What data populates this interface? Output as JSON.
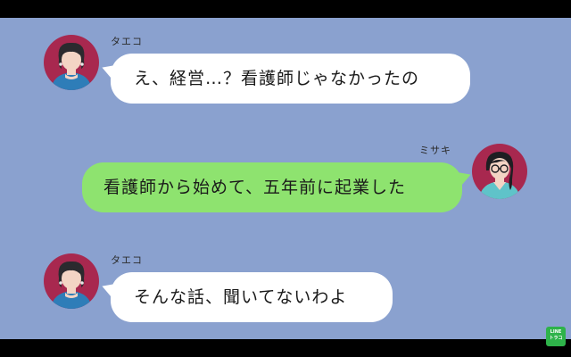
{
  "messages": [
    {
      "sender": "タエコ",
      "side": "left",
      "text": "え、経営…？看護師じゃなかったの"
    },
    {
      "sender": "ミサキ",
      "side": "right",
      "text": "看護師から始めて、五年前に起業した"
    },
    {
      "sender": "タエコ",
      "side": "left",
      "text": "そんな話、聞いてないわよ"
    }
  ],
  "logo": {
    "line1": "LINE",
    "line2": "トラコ"
  },
  "colors": {
    "background": "#8aa1cf",
    "incoming_bubble": "#ffffff",
    "outgoing_bubble": "#8ee36f",
    "avatar_taeko_bg": "#a8284f",
    "avatar_misaki_bg": "#a8284f",
    "letterbox": "#000000"
  }
}
